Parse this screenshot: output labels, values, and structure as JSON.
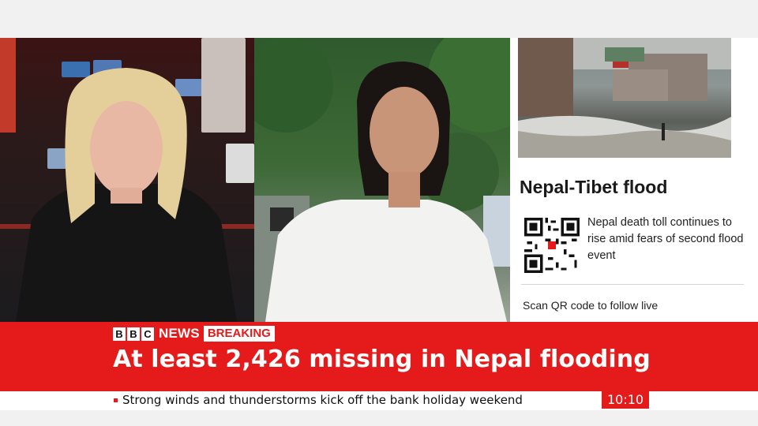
{
  "side_panel": {
    "title": "Nepal-Tibet flood",
    "description": "Nepal death toll continues to rise amid fears of second flood event",
    "scan_text": "Scan QR code to follow live"
  },
  "strap": {
    "brand_letters": [
      "B",
      "B",
      "C"
    ],
    "brand_word": "NEWS",
    "badge": "BREAKING",
    "headline": "At least 2,426 missing in Nepal flooding"
  },
  "ticker": {
    "text": "Strong winds and thunderstorms kick off the bank holiday weekend",
    "time": "10:10"
  },
  "colors": {
    "accent_red": "#e51a1a",
    "panel_white": "#ffffff",
    "background": "#f1f1f1"
  }
}
